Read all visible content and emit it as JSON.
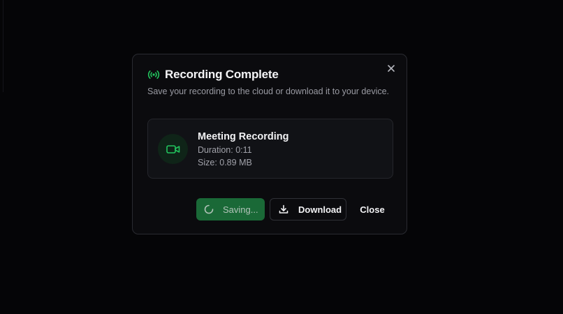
{
  "dialog": {
    "title": "Recording Complete",
    "subtitle": "Save your recording to the cloud or download it to your device.",
    "recording": {
      "name": "Meeting Recording",
      "duration": "Duration: 0:11",
      "size": "Size: 0.89 MB"
    },
    "buttons": {
      "saving_label": "Saving...",
      "download_label": "Download",
      "close_label": "Close"
    }
  },
  "colors": {
    "accent_green": "#22c55e",
    "save_button": "#1d7a3f",
    "dialog_bg": "#0b0b0e",
    "page_bg": "#050507"
  },
  "icons": {
    "title": "broadcast-icon",
    "close": "close-icon",
    "recording": "video-camera-icon",
    "saving": "spinner-icon",
    "download": "download-icon"
  }
}
